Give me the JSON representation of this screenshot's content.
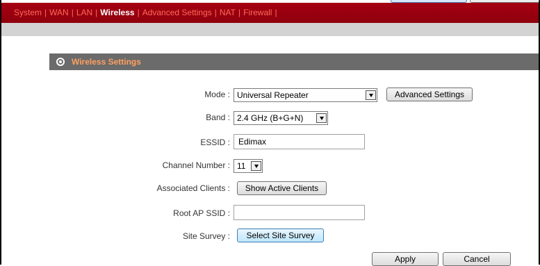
{
  "nav": {
    "items": [
      {
        "label": "System",
        "active": false
      },
      {
        "label": "WAN",
        "active": false
      },
      {
        "label": "LAN",
        "active": false
      },
      {
        "label": "Wireless",
        "active": true
      },
      {
        "label": "Advanced Settings",
        "active": false
      },
      {
        "label": "NAT",
        "active": false
      },
      {
        "label": "Firewall",
        "active": false
      }
    ],
    "separator": "|"
  },
  "section": {
    "title": "Wireless Settings"
  },
  "form": {
    "mode_label": "Mode :",
    "mode_value": "Universal Repeater",
    "advanced_button": "Advanced Settings",
    "band_label": "Band :",
    "band_value": "2.4 GHz (B+G+N)",
    "essid_label": "ESSID :",
    "essid_value": "Edimax",
    "channel_label": "Channel Number :",
    "channel_value": "11",
    "clients_label": "Associated Clients :",
    "clients_button": "Show Active Clients",
    "rootap_label": "Root AP SSID :",
    "rootap_value": "",
    "survey_label": "Site Survey :",
    "survey_button": "Select Site Survey"
  },
  "actions": {
    "apply": "Apply",
    "cancel": "Cancel"
  },
  "colors": {
    "nav_bg": "#9b000f",
    "nav_text": "#ff6a5a",
    "nav_active": "#ffffff",
    "section_bg": "#6b6b6b",
    "section_title": "#ffa060"
  }
}
